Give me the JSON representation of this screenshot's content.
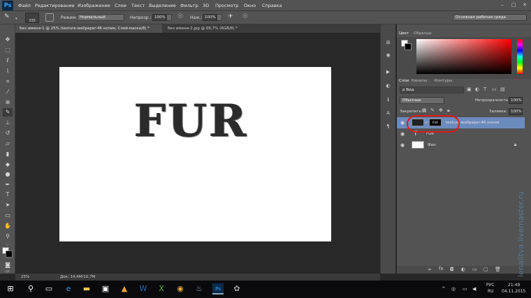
{
  "app": {
    "logo": "Ps"
  },
  "menu": [
    "Файл",
    "Редактирование",
    "Изображение",
    "Слои",
    "Текст",
    "Выделение",
    "Фильтр",
    "3D",
    "Просмотр",
    "Окно",
    "Справка"
  ],
  "options": {
    "brush_size": "335",
    "mode_label": "Режим:",
    "mode_value": "Нормальный",
    "opacity_label": "Непрозр.:",
    "opacity_value": "100%",
    "pressure_label": "Наж.:",
    "pressure_value": "100%",
    "workspace": "Основная рабочая среда"
  },
  "tabs": [
    {
      "label": "Без имени-1 @ 25% (texture-wallpaper-46 копия, Слой-маска/8) *"
    },
    {
      "label": "Без имени-2.jpg @ 66,7% (RGB/8) *"
    }
  ],
  "canvas": {
    "text": "FUR"
  },
  "status": {
    "zoom": "25%",
    "doc": "Док: 14,4M/10,7M"
  },
  "panels": {
    "color_tabs": [
      "Цвет",
      "Образцы"
    ],
    "layer_tabs": [
      "Слои",
      "Каналы",
      "Контуры"
    ],
    "filter_label": "ρ Вид",
    "blend_mode": "Обычные",
    "opacity_label": "Непрозрачность:",
    "opacity_value": "100%",
    "lock_label": "Закрепить:",
    "fill_label": "Заливка:",
    "fill_value": "100%",
    "layers": [
      {
        "name": "texture-wallpaper-46 копия",
        "type": "image"
      },
      {
        "name": "FUR",
        "type": "text"
      },
      {
        "name": "Фон",
        "type": "background"
      }
    ],
    "mask_thumb_text": "FUR"
  },
  "taskbar": {
    "lang": "РУС",
    "lang2": "RU",
    "time": "21:49",
    "date": "04.11.2015"
  },
  "watermark": "lenalitva.livemaster.ru"
}
